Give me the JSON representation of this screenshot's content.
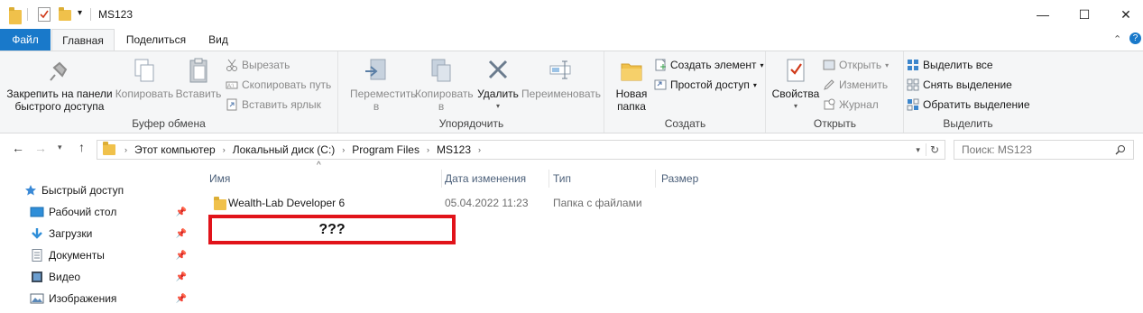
{
  "window": {
    "title": "MS123",
    "minimize": "—",
    "maximize": "☐",
    "close": "✕"
  },
  "tabs": [
    "Файл",
    "Главная",
    "Поделиться",
    "Вид"
  ],
  "ribbon": {
    "clipboard": {
      "label": "Буфер обмена",
      "pin": "Закрепить на панели быстрого доступа",
      "copy": "Копировать",
      "paste": "Вставить",
      "cut": "Вырезать",
      "copy_path": "Скопировать путь",
      "paste_shortcut": "Вставить ярлык"
    },
    "organize": {
      "label": "Упорядочить",
      "move": "Переместить в",
      "copy_to": "Копировать в",
      "delete": "Удалить",
      "rename": "Переименовать"
    },
    "create": {
      "label": "Создать",
      "new_folder": "Новая папка",
      "new_item": "Создать элемент",
      "easy_access": "Простой доступ"
    },
    "open": {
      "label": "Открыть",
      "properties": "Свойства",
      "open": "Открыть",
      "edit": "Изменить",
      "history": "Журнал"
    },
    "select": {
      "label": "Выделить",
      "select_all": "Выделить все",
      "select_none": "Снять выделение",
      "invert": "Обратить выделение"
    }
  },
  "address": {
    "crumbs": [
      "Этот компьютер",
      "Локальный диск (C:)",
      "Program Files",
      "MS123"
    ],
    "search_placeholder": "Поиск: MS123"
  },
  "nav": [
    {
      "label": "Быстрый доступ",
      "icon": "star-icon"
    },
    {
      "label": "Рабочий стол",
      "icon": "desktop-icon"
    },
    {
      "label": "Загрузки",
      "icon": "download-icon"
    },
    {
      "label": "Документы",
      "icon": "document-icon"
    },
    {
      "label": "Видео",
      "icon": "video-icon"
    },
    {
      "label": "Изображения",
      "icon": "image-icon"
    }
  ],
  "columns": [
    "Имя",
    "Дата изменения",
    "Тип",
    "Размер"
  ],
  "files": [
    {
      "name": "Wealth-Lab Developer 6",
      "date": "05.04.2022 11:23",
      "type": "Папка с файлами",
      "size": ""
    }
  ],
  "annotation": {
    "text": "???",
    "color": "#e1131a"
  },
  "colors": {
    "accent": "#1979ca",
    "file_tab": "#1979ca"
  }
}
